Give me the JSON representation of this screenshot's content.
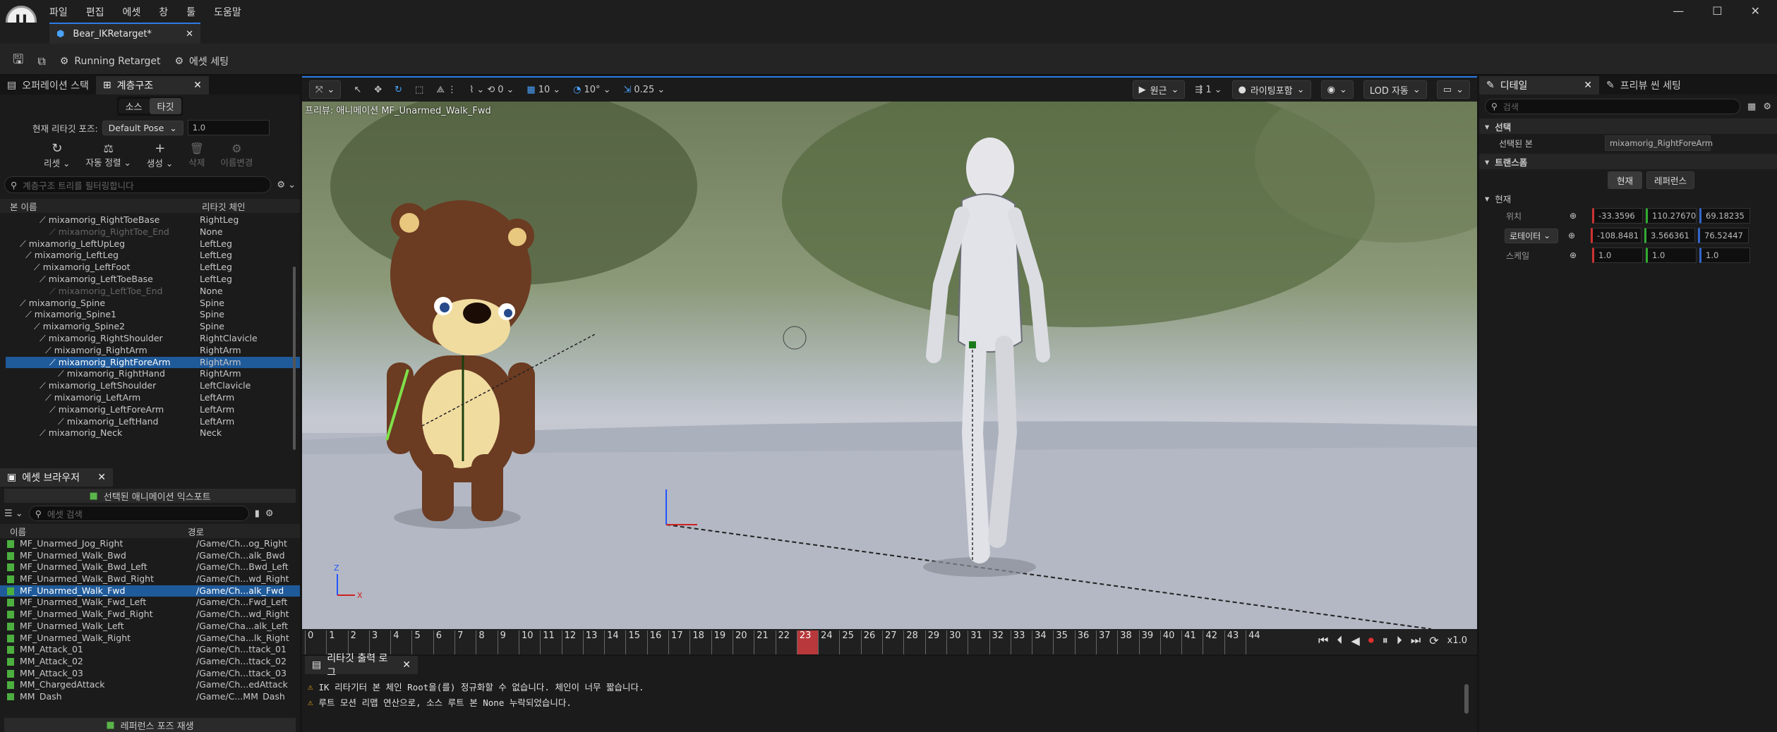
{
  "menu": [
    "파일",
    "편집",
    "에셋",
    "창",
    "툴",
    "도움말"
  ],
  "doc_tab": "Bear_IKRetarget*",
  "toolbar": {
    "running": "Running Retarget",
    "settings": "에셋 세팅"
  },
  "left_tabs": {
    "ops": "오퍼레이션 스택",
    "hier": "계층구조"
  },
  "src_tgt": {
    "src": "소스",
    "tgt": "타깃"
  },
  "pose": {
    "label": "현재 리타깃 포즈:",
    "value": "Default Pose",
    "num": "1.0"
  },
  "tools": [
    "리셋",
    "자동 정렬",
    "생성",
    "삭제",
    "이름변경"
  ],
  "filter_placeholder": "계층구조 트리를 필터링합니다",
  "tree_headers": {
    "name": "본 이름",
    "chain": "리타깃 체인"
  },
  "bones": [
    {
      "name": "mixamorig_RightToeBase",
      "chain": "RightLeg",
      "indent": 48
    },
    {
      "name": "mixamorig_RightToe_End",
      "chain": "None",
      "indent": 62,
      "dim": true
    },
    {
      "name": "mixamorig_LeftUpLeg",
      "chain": "LeftLeg",
      "indent": 20
    },
    {
      "name": "mixamorig_LeftLeg",
      "chain": "LeftLeg",
      "indent": 28
    },
    {
      "name": "mixamorig_LeftFoot",
      "chain": "LeftLeg",
      "indent": 40
    },
    {
      "name": "mixamorig_LeftToeBase",
      "chain": "LeftLeg",
      "indent": 48
    },
    {
      "name": "mixamorig_LeftToe_End",
      "chain": "None",
      "indent": 62,
      "dim": true
    },
    {
      "name": "mixamorig_Spine",
      "chain": "Spine",
      "indent": 20
    },
    {
      "name": "mixamorig_Spine1",
      "chain": "Spine",
      "indent": 28
    },
    {
      "name": "mixamorig_Spine2",
      "chain": "Spine",
      "indent": 40
    },
    {
      "name": "mixamorig_RightShoulder",
      "chain": "RightClavicle",
      "indent": 48
    },
    {
      "name": "mixamorig_RightArm",
      "chain": "RightArm",
      "indent": 56
    },
    {
      "name": "mixamorig_RightForeArm",
      "chain": "RightArm",
      "indent": 62,
      "sel": true
    },
    {
      "name": "mixamorig_RightHand",
      "chain": "RightArm",
      "indent": 74
    },
    {
      "name": "mixamorig_LeftShoulder",
      "chain": "LeftClavicle",
      "indent": 48
    },
    {
      "name": "mixamorig_LeftArm",
      "chain": "LeftArm",
      "indent": 56
    },
    {
      "name": "mixamorig_LeftForeArm",
      "chain": "LeftArm",
      "indent": 62
    },
    {
      "name": "mixamorig_LeftHand",
      "chain": "LeftArm",
      "indent": 74
    },
    {
      "name": "mixamorig_Neck",
      "chain": "Neck",
      "indent": 48
    }
  ],
  "asset_browser": {
    "title": "에셋 브라우저",
    "export": "선택된 애니메이션 익스포트",
    "search": "에셋 검색",
    "col_name": "이름",
    "col_path": "경로",
    "play_ref": "레퍼런스 포즈 재생"
  },
  "assets": [
    {
      "name": "MF_Unarmed_Jog_Right",
      "path": "/Game/Ch...og_Right"
    },
    {
      "name": "MF_Unarmed_Walk_Bwd",
      "path": "/Game/Ch...alk_Bwd"
    },
    {
      "name": "MF_Unarmed_Walk_Bwd_Left",
      "path": "/Game/Ch...Bwd_Left"
    },
    {
      "name": "MF_Unarmed_Walk_Bwd_Right",
      "path": "/Game/Ch...wd_Right"
    },
    {
      "name": "MF_Unarmed_Walk_Fwd",
      "path": "/Game/Ch...alk_Fwd",
      "sel": true
    },
    {
      "name": "MF_Unarmed_Walk_Fwd_Left",
      "path": "/Game/Ch...Fwd_Left"
    },
    {
      "name": "MF_Unarmed_Walk_Fwd_Right",
      "path": "/Game/Ch...wd_Right"
    },
    {
      "name": "MF_Unarmed_Walk_Left",
      "path": "/Game/Cha...alk_Left"
    },
    {
      "name": "MF_Unarmed_Walk_Right",
      "path": "/Game/Cha...lk_Right"
    },
    {
      "name": "MM_Attack_01",
      "path": "/Game/Ch...ttack_01"
    },
    {
      "name": "MM_Attack_02",
      "path": "/Game/Ch...ttack_02"
    },
    {
      "name": "MM_Attack_03",
      "path": "/Game/Ch...ttack_03"
    },
    {
      "name": "MM_ChargedAttack",
      "path": "/Game/Ch...edAttack"
    },
    {
      "name": "MM_Dash",
      "path": "/Game/C...MM_Dash"
    }
  ],
  "viewport": {
    "preview": "프리뷰: 애니메이션 MF_Unarmed_Walk_Fwd",
    "snap_rot": "0",
    "grid": "10",
    "angle": "10°",
    "scale": "0.25",
    "persp": "원근",
    "speed": "1",
    "lit": "라이팅포함",
    "lod": "LOD 자동"
  },
  "timeline": {
    "frames": [
      "0",
      "1",
      "2",
      "3",
      "4",
      "5",
      "6",
      "7",
      "8",
      "9",
      "10",
      "11",
      "12",
      "13",
      "14",
      "15",
      "16",
      "17",
      "18",
      "19",
      "20",
      "21",
      "22",
      "23",
      "24",
      "25",
      "26",
      "27",
      "28",
      "29",
      "30",
      "31",
      "32",
      "33",
      "34",
      "35",
      "36",
      "37",
      "38",
      "39",
      "40",
      "41",
      "42",
      "43",
      "44"
    ],
    "current": "23",
    "speed": "x1.0"
  },
  "log": {
    "title": "리타깃 출력 로그",
    "lines": [
      "IK 리타기터 본 체인 Root을(를) 정규화할 수 없습니다. 체인이 너무 짧습니다.",
      "루트 모션 리맵 연산으로, 소스 루트 본 None 누락되었습니다."
    ]
  },
  "details": {
    "tab1": "디테일",
    "tab2": "프리뷰 씬 세팅",
    "search": "검색",
    "sec_sel": "선택",
    "sel_bone_label": "선택된 본",
    "sel_bone": "mixamorig_RightForeArm",
    "sec_xform": "트랜스폼",
    "cur_btn": "현재",
    "ref_btn": "레퍼런스",
    "sec_cur": "현재",
    "loc_label": "위치",
    "rot_label": "로테이터",
    "scale_label": "스케일",
    "loc": [
      "-33.3596",
      "110.27670",
      "69.18235"
    ],
    "rot": [
      "-108.8481",
      "3.566361",
      "76.52447"
    ],
    "scl": [
      "1.0",
      "1.0",
      "1.0"
    ]
  }
}
